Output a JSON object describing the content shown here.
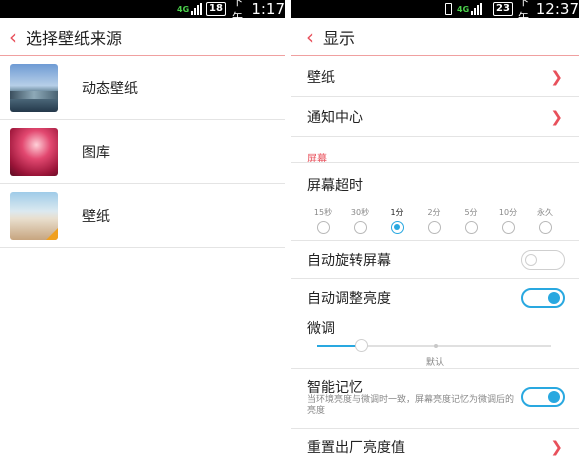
{
  "left": {
    "status": {
      "network": "4G",
      "battery": "18",
      "time_prefix": "下午",
      "time": "1:17"
    },
    "header": {
      "title": "选择壁纸来源"
    },
    "items": [
      {
        "label": "动态壁纸",
        "icon": "live-wallpaper-thumbnail"
      },
      {
        "label": "图库",
        "icon": "gallery-thumbnail"
      },
      {
        "label": "壁纸",
        "icon": "wallpaper-thumbnail"
      }
    ]
  },
  "right": {
    "status": {
      "network": "4G",
      "battery": "23",
      "time_prefix": "下午",
      "time": "12:37"
    },
    "header": {
      "title": "显示"
    },
    "wallpaper_label": "壁纸",
    "notification_label": "通知中心",
    "section_label": "屏幕",
    "timeout": {
      "label": "屏幕超时",
      "options": [
        "15秒",
        "30秒",
        "1分",
        "2分",
        "5分",
        "10分",
        "永久"
      ],
      "selected": "1分"
    },
    "auto_rotate": {
      "label": "自动旋转屏幕",
      "on": false
    },
    "auto_brightness": {
      "label": "自动调整亮度",
      "on": true
    },
    "fine_tune": {
      "label": "微调",
      "default_label": "默认",
      "level": 0.19
    },
    "smart_memory": {
      "label": "智能记忆",
      "desc": "当环境亮度与微调时一致，屏幕亮度记忆为微调后的亮度",
      "on": true
    },
    "reset_label": "重置出厂亮度值"
  },
  "colors": {
    "accent": "#e8505b",
    "toggle_on": "#29a8e0",
    "divider": "#e4e4e4"
  }
}
